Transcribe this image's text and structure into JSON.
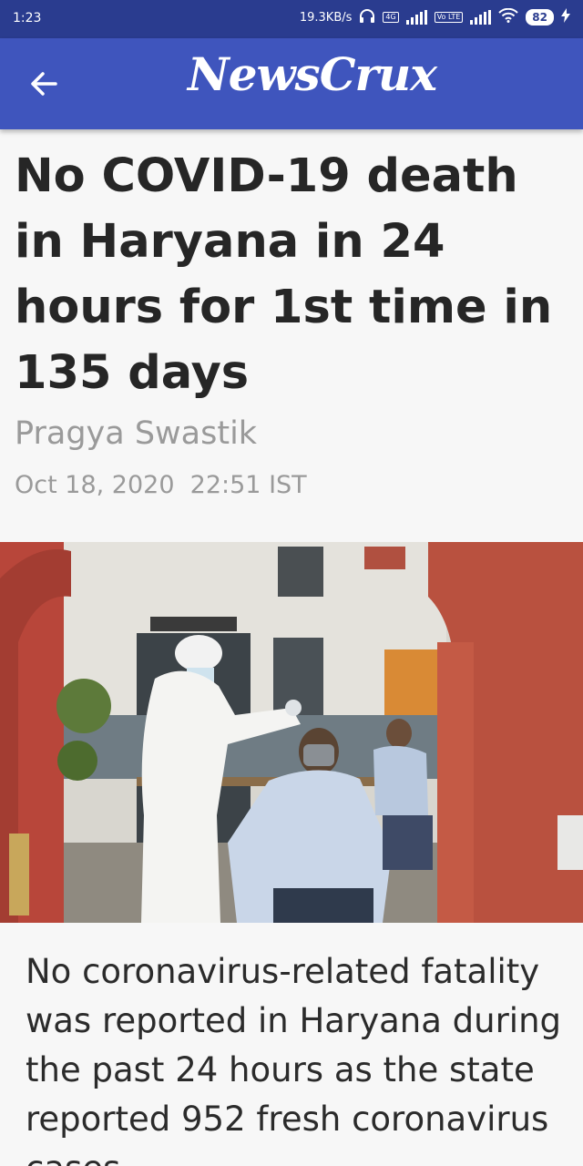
{
  "status_bar": {
    "time": "1:23",
    "network_speed": "19.3KB/s",
    "network_tag": "4G",
    "volte_tag": "Vo LTE",
    "battery": "82"
  },
  "app_bar": {
    "logo": "NewsCrux",
    "back_icon": "arrow-left-icon"
  },
  "article": {
    "headline": "No COVID-19 death in Haryana in 24 hours for 1st time in 135 days",
    "author": "Pragya Swastik",
    "date": "Oct 18, 2020",
    "time": "22:51 IST",
    "body": "No coronavirus-related fatality was reported in Haryana during the past 24 hours as the state reported 952 fresh coronavirus cases"
  },
  "colors": {
    "status_bar": "#2a3c8f",
    "app_bar": "#3f55bd",
    "headline": "#262626",
    "meta": "#9a9a9a"
  }
}
